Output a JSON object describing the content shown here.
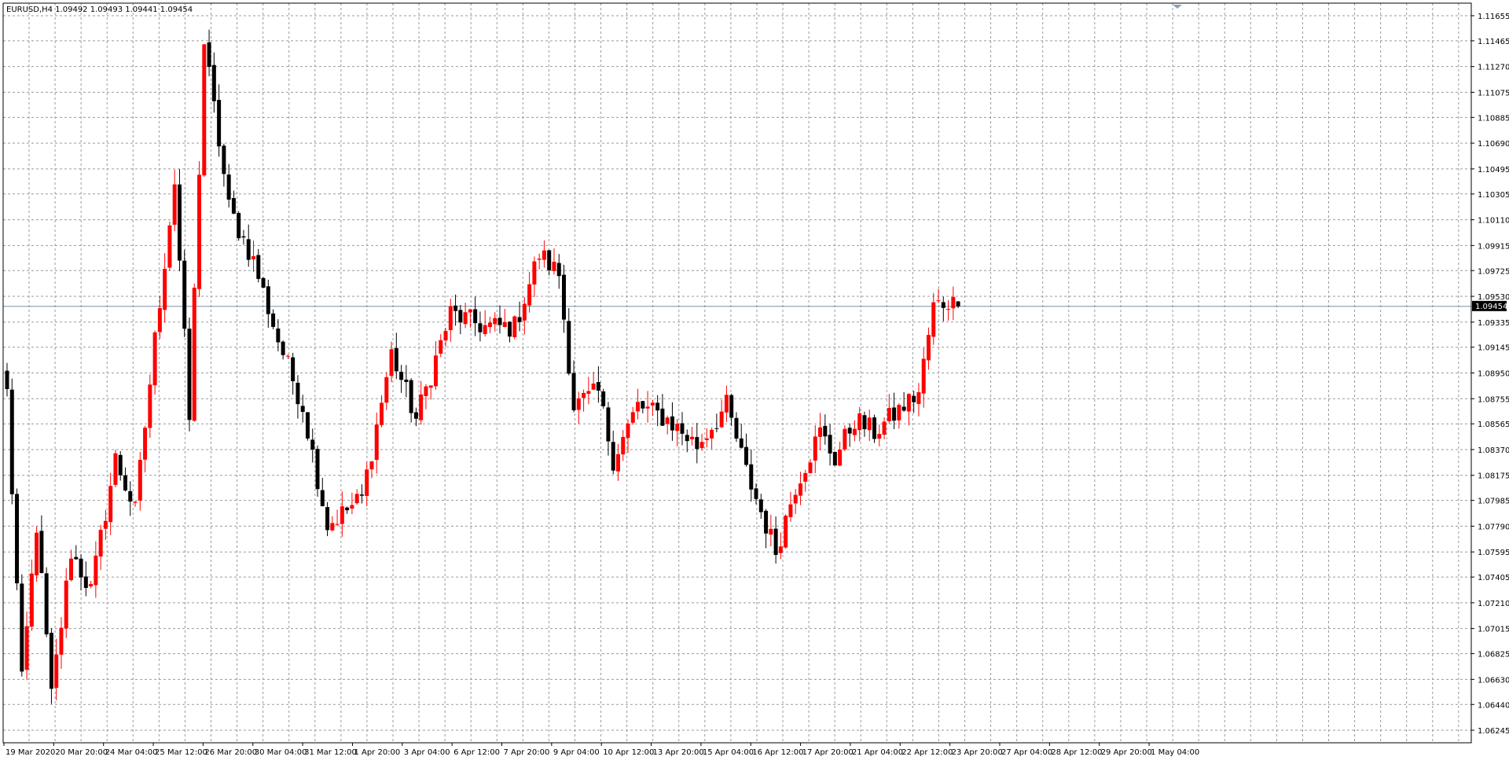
{
  "window": {
    "info_line": "EURUSD,H4  1.09492 1.09493 1.09441 1.09454"
  },
  "current_price_label": "1.09454",
  "chart_data": {
    "type": "candlestick",
    "symbol": "EURUSD",
    "timeframe": "H4",
    "last_bar": {
      "open": 1.09492,
      "high": 1.09493,
      "low": 1.09441,
      "close": 1.09454
    },
    "price_axis": {
      "side": "right",
      "range": [
        1.0615,
        1.1175
      ],
      "ticks": [
        "1.11655",
        "1.11465",
        "1.11270",
        "1.11075",
        "1.10885",
        "1.10690",
        "1.10495",
        "1.10305",
        "1.10110",
        "1.09915",
        "1.09725",
        "1.09530",
        "1.09335",
        "1.09145",
        "1.08950",
        "1.08755",
        "1.08565",
        "1.08370",
        "1.08175",
        "1.07985",
        "1.07790",
        "1.07595",
        "1.07405",
        "1.07210",
        "1.07015",
        "1.06825",
        "1.06630",
        "1.06440",
        "1.06245"
      ]
    },
    "time_axis_labels": [
      "19 Mar 2020",
      "20 Mar 20:00",
      "24 Mar 04:00",
      "25 Mar 12:00",
      "26 Mar 20:00",
      "30 Mar 04:00",
      "31 Mar 12:00",
      "1 Apr 20:00",
      "3 Apr 04:00",
      "6 Apr 12:00",
      "7 Apr 20:00",
      "9 Apr 04:00",
      "10 Apr 12:00",
      "13 Apr 20:00",
      "15 Apr 04:00",
      "16 Apr 12:00",
      "17 Apr 20:00",
      "21 Apr 04:00",
      "22 Apr 12:00",
      "23 Apr 20:00",
      "27 Apr 04:00",
      "28 Apr 12:00",
      "29 Apr 20:00",
      "1 May 04:00"
    ],
    "grid": true,
    "bull_color": "#ff0000",
    "bear_color": "#000000",
    "waypoints": [
      [
        0,
        1.088
      ],
      [
        3,
        1.066
      ],
      [
        6,
        1.078
      ],
      [
        9,
        1.065
      ],
      [
        13,
        1.076
      ],
      [
        17,
        1.073
      ],
      [
        22,
        1.083
      ],
      [
        26,
        1.079
      ],
      [
        30,
        1.092
      ],
      [
        34,
        1.104
      ],
      [
        37,
        1.086
      ],
      [
        40,
        1.1145
      ],
      [
        45,
        1.102
      ],
      [
        50,
        1.098
      ],
      [
        55,
        1.092
      ],
      [
        60,
        1.087
      ],
      [
        65,
        1.078
      ],
      [
        72,
        1.08
      ],
      [
        78,
        1.091
      ],
      [
        83,
        1.086
      ],
      [
        90,
        1.094
      ],
      [
        97,
        1.093
      ],
      [
        103,
        1.093
      ],
      [
        108,
        1.0985
      ],
      [
        112,
        1.097
      ],
      [
        115,
        1.087
      ],
      [
        120,
        1.088
      ],
      [
        123,
        1.083
      ],
      [
        128,
        1.087
      ],
      [
        134,
        1.086
      ],
      [
        140,
        1.084
      ],
      [
        146,
        1.087
      ],
      [
        150,
        1.082
      ],
      [
        156,
        1.076
      ],
      [
        160,
        1.081
      ],
      [
        165,
        1.085
      ],
      [
        168,
        1.083
      ],
      [
        172,
        1.086
      ],
      [
        176,
        1.085
      ],
      [
        182,
        1.087
      ],
      [
        185,
        1.088
      ],
      [
        188,
        1.0945
      ],
      [
        191,
        1.095
      ],
      [
        193,
        1.09454
      ]
    ]
  }
}
